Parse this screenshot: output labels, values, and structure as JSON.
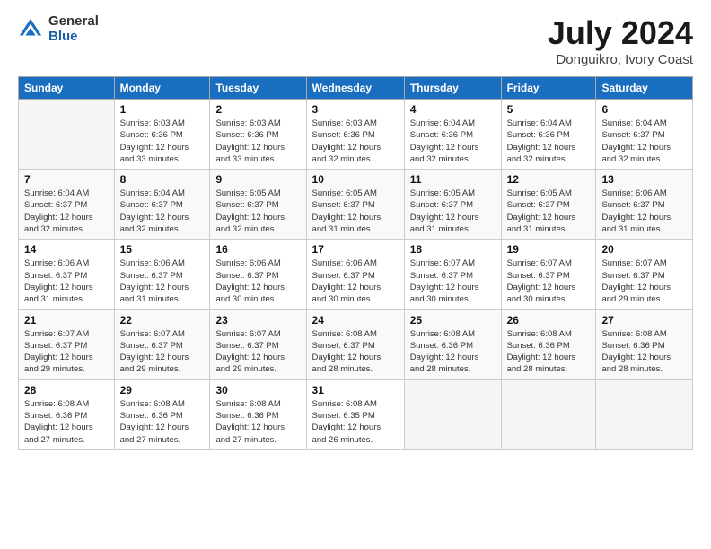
{
  "logo": {
    "general": "General",
    "blue": "Blue"
  },
  "header": {
    "title": "July 2024",
    "subtitle": "Donguikro, Ivory Coast"
  },
  "weekdays": [
    "Sunday",
    "Monday",
    "Tuesday",
    "Wednesday",
    "Thursday",
    "Friday",
    "Saturday"
  ],
  "weeks": [
    [
      {
        "day": "",
        "info": ""
      },
      {
        "day": "1",
        "info": "Sunrise: 6:03 AM\nSunset: 6:36 PM\nDaylight: 12 hours\nand 33 minutes."
      },
      {
        "day": "2",
        "info": "Sunrise: 6:03 AM\nSunset: 6:36 PM\nDaylight: 12 hours\nand 33 minutes."
      },
      {
        "day": "3",
        "info": "Sunrise: 6:03 AM\nSunset: 6:36 PM\nDaylight: 12 hours\nand 32 minutes."
      },
      {
        "day": "4",
        "info": "Sunrise: 6:04 AM\nSunset: 6:36 PM\nDaylight: 12 hours\nand 32 minutes."
      },
      {
        "day": "5",
        "info": "Sunrise: 6:04 AM\nSunset: 6:36 PM\nDaylight: 12 hours\nand 32 minutes."
      },
      {
        "day": "6",
        "info": "Sunrise: 6:04 AM\nSunset: 6:37 PM\nDaylight: 12 hours\nand 32 minutes."
      }
    ],
    [
      {
        "day": "7",
        "info": "Sunrise: 6:04 AM\nSunset: 6:37 PM\nDaylight: 12 hours\nand 32 minutes."
      },
      {
        "day": "8",
        "info": "Sunrise: 6:04 AM\nSunset: 6:37 PM\nDaylight: 12 hours\nand 32 minutes."
      },
      {
        "day": "9",
        "info": "Sunrise: 6:05 AM\nSunset: 6:37 PM\nDaylight: 12 hours\nand 32 minutes."
      },
      {
        "day": "10",
        "info": "Sunrise: 6:05 AM\nSunset: 6:37 PM\nDaylight: 12 hours\nand 31 minutes."
      },
      {
        "day": "11",
        "info": "Sunrise: 6:05 AM\nSunset: 6:37 PM\nDaylight: 12 hours\nand 31 minutes."
      },
      {
        "day": "12",
        "info": "Sunrise: 6:05 AM\nSunset: 6:37 PM\nDaylight: 12 hours\nand 31 minutes."
      },
      {
        "day": "13",
        "info": "Sunrise: 6:06 AM\nSunset: 6:37 PM\nDaylight: 12 hours\nand 31 minutes."
      }
    ],
    [
      {
        "day": "14",
        "info": "Sunrise: 6:06 AM\nSunset: 6:37 PM\nDaylight: 12 hours\nand 31 minutes."
      },
      {
        "day": "15",
        "info": "Sunrise: 6:06 AM\nSunset: 6:37 PM\nDaylight: 12 hours\nand 31 minutes."
      },
      {
        "day": "16",
        "info": "Sunrise: 6:06 AM\nSunset: 6:37 PM\nDaylight: 12 hours\nand 30 minutes."
      },
      {
        "day": "17",
        "info": "Sunrise: 6:06 AM\nSunset: 6:37 PM\nDaylight: 12 hours\nand 30 minutes."
      },
      {
        "day": "18",
        "info": "Sunrise: 6:07 AM\nSunset: 6:37 PM\nDaylight: 12 hours\nand 30 minutes."
      },
      {
        "day": "19",
        "info": "Sunrise: 6:07 AM\nSunset: 6:37 PM\nDaylight: 12 hours\nand 30 minutes."
      },
      {
        "day": "20",
        "info": "Sunrise: 6:07 AM\nSunset: 6:37 PM\nDaylight: 12 hours\nand 29 minutes."
      }
    ],
    [
      {
        "day": "21",
        "info": "Sunrise: 6:07 AM\nSunset: 6:37 PM\nDaylight: 12 hours\nand 29 minutes."
      },
      {
        "day": "22",
        "info": "Sunrise: 6:07 AM\nSunset: 6:37 PM\nDaylight: 12 hours\nand 29 minutes."
      },
      {
        "day": "23",
        "info": "Sunrise: 6:07 AM\nSunset: 6:37 PM\nDaylight: 12 hours\nand 29 minutes."
      },
      {
        "day": "24",
        "info": "Sunrise: 6:08 AM\nSunset: 6:37 PM\nDaylight: 12 hours\nand 28 minutes."
      },
      {
        "day": "25",
        "info": "Sunrise: 6:08 AM\nSunset: 6:36 PM\nDaylight: 12 hours\nand 28 minutes."
      },
      {
        "day": "26",
        "info": "Sunrise: 6:08 AM\nSunset: 6:36 PM\nDaylight: 12 hours\nand 28 minutes."
      },
      {
        "day": "27",
        "info": "Sunrise: 6:08 AM\nSunset: 6:36 PM\nDaylight: 12 hours\nand 28 minutes."
      }
    ],
    [
      {
        "day": "28",
        "info": "Sunrise: 6:08 AM\nSunset: 6:36 PM\nDaylight: 12 hours\nand 27 minutes."
      },
      {
        "day": "29",
        "info": "Sunrise: 6:08 AM\nSunset: 6:36 PM\nDaylight: 12 hours\nand 27 minutes."
      },
      {
        "day": "30",
        "info": "Sunrise: 6:08 AM\nSunset: 6:36 PM\nDaylight: 12 hours\nand 27 minutes."
      },
      {
        "day": "31",
        "info": "Sunrise: 6:08 AM\nSunset: 6:35 PM\nDaylight: 12 hours\nand 26 minutes."
      },
      {
        "day": "",
        "info": ""
      },
      {
        "day": "",
        "info": ""
      },
      {
        "day": "",
        "info": ""
      }
    ]
  ]
}
